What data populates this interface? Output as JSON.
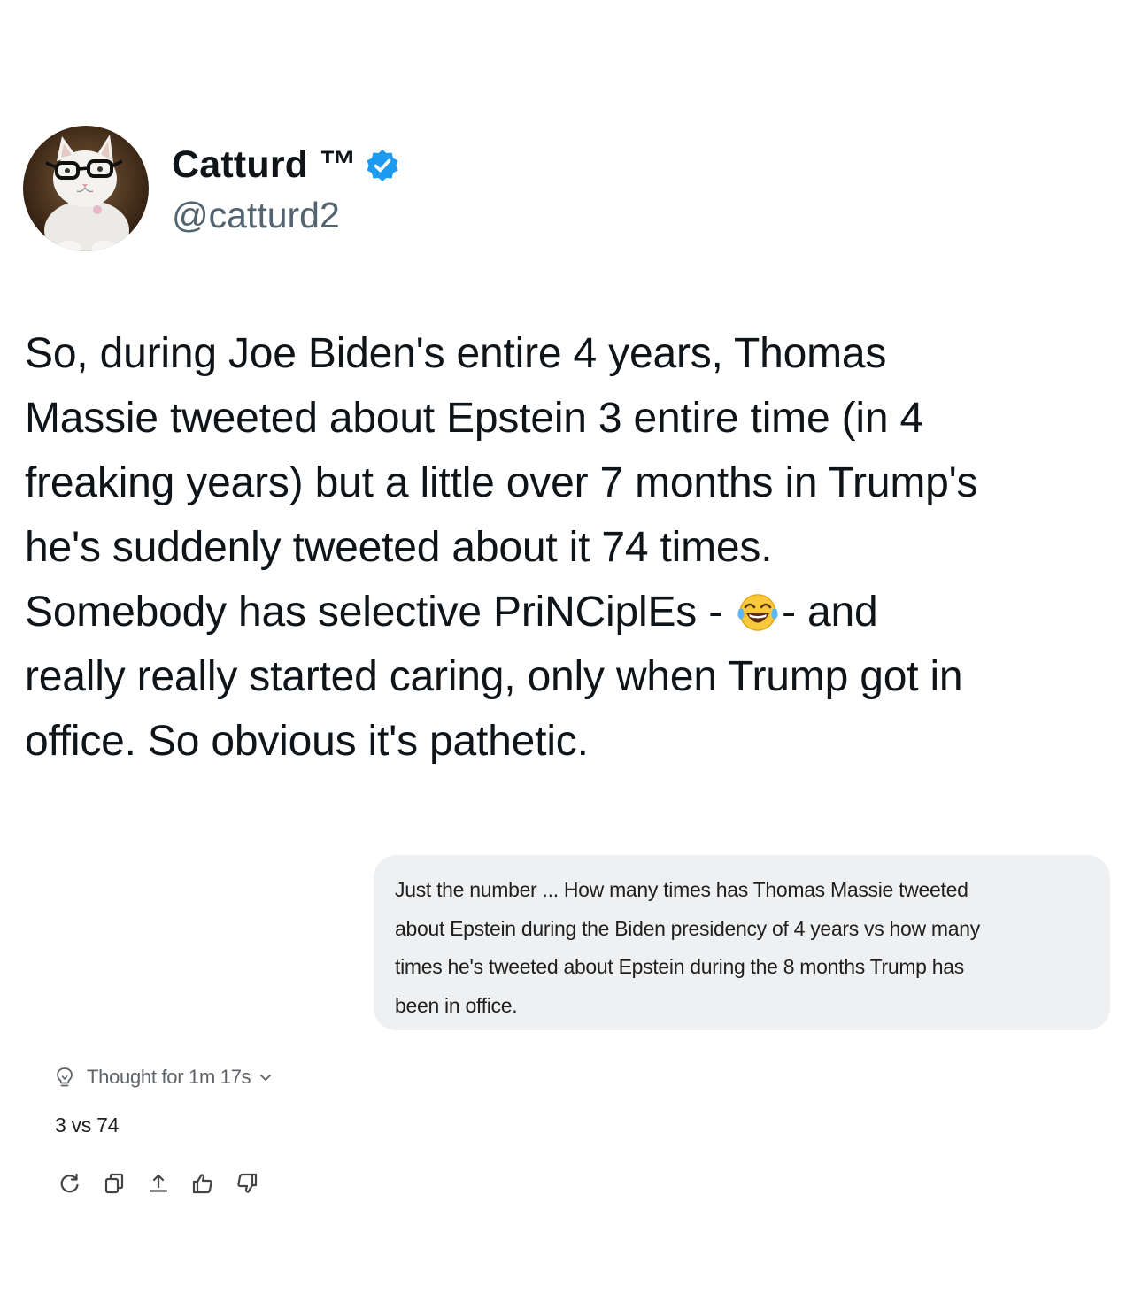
{
  "tweet": {
    "author": {
      "display_name": "Catturd ™",
      "handle": "@catturd2",
      "verified": true,
      "verified_color": "#1d9bf0",
      "avatar_icon": "cat-with-glasses-avatar"
    },
    "text_lines": [
      "So, during Joe Biden's entire 4 years, Thomas",
      "Massie tweeted about Epstein 3 entire time (in 4",
      "freaking years) but a little over 7 months in Trump's",
      "he's suddenly tweeted about it 74 times.",
      "Somebody has selective PriNCiplEs - ",
      "- and",
      "really really started caring, only when Trump got in",
      "office. So obvious it's pathetic."
    ],
    "emoji": "face-with-tears-of-joy"
  },
  "chat": {
    "user_message_lines": [
      "Just the number ... How many times has Thomas Massie tweeted",
      "about Epstein during the Biden presidency of 4 years vs how many",
      "times he's tweeted about Epstein during the 8 months Trump has",
      "been in office."
    ],
    "thought_label": "Thought for 1m 17s",
    "answer": "3 vs 74",
    "actions": [
      {
        "icon": "regenerate-icon"
      },
      {
        "icon": "copy-icon"
      },
      {
        "icon": "share-icon"
      },
      {
        "icon": "thumbs-up-icon"
      },
      {
        "icon": "thumbs-down-icon"
      }
    ]
  }
}
